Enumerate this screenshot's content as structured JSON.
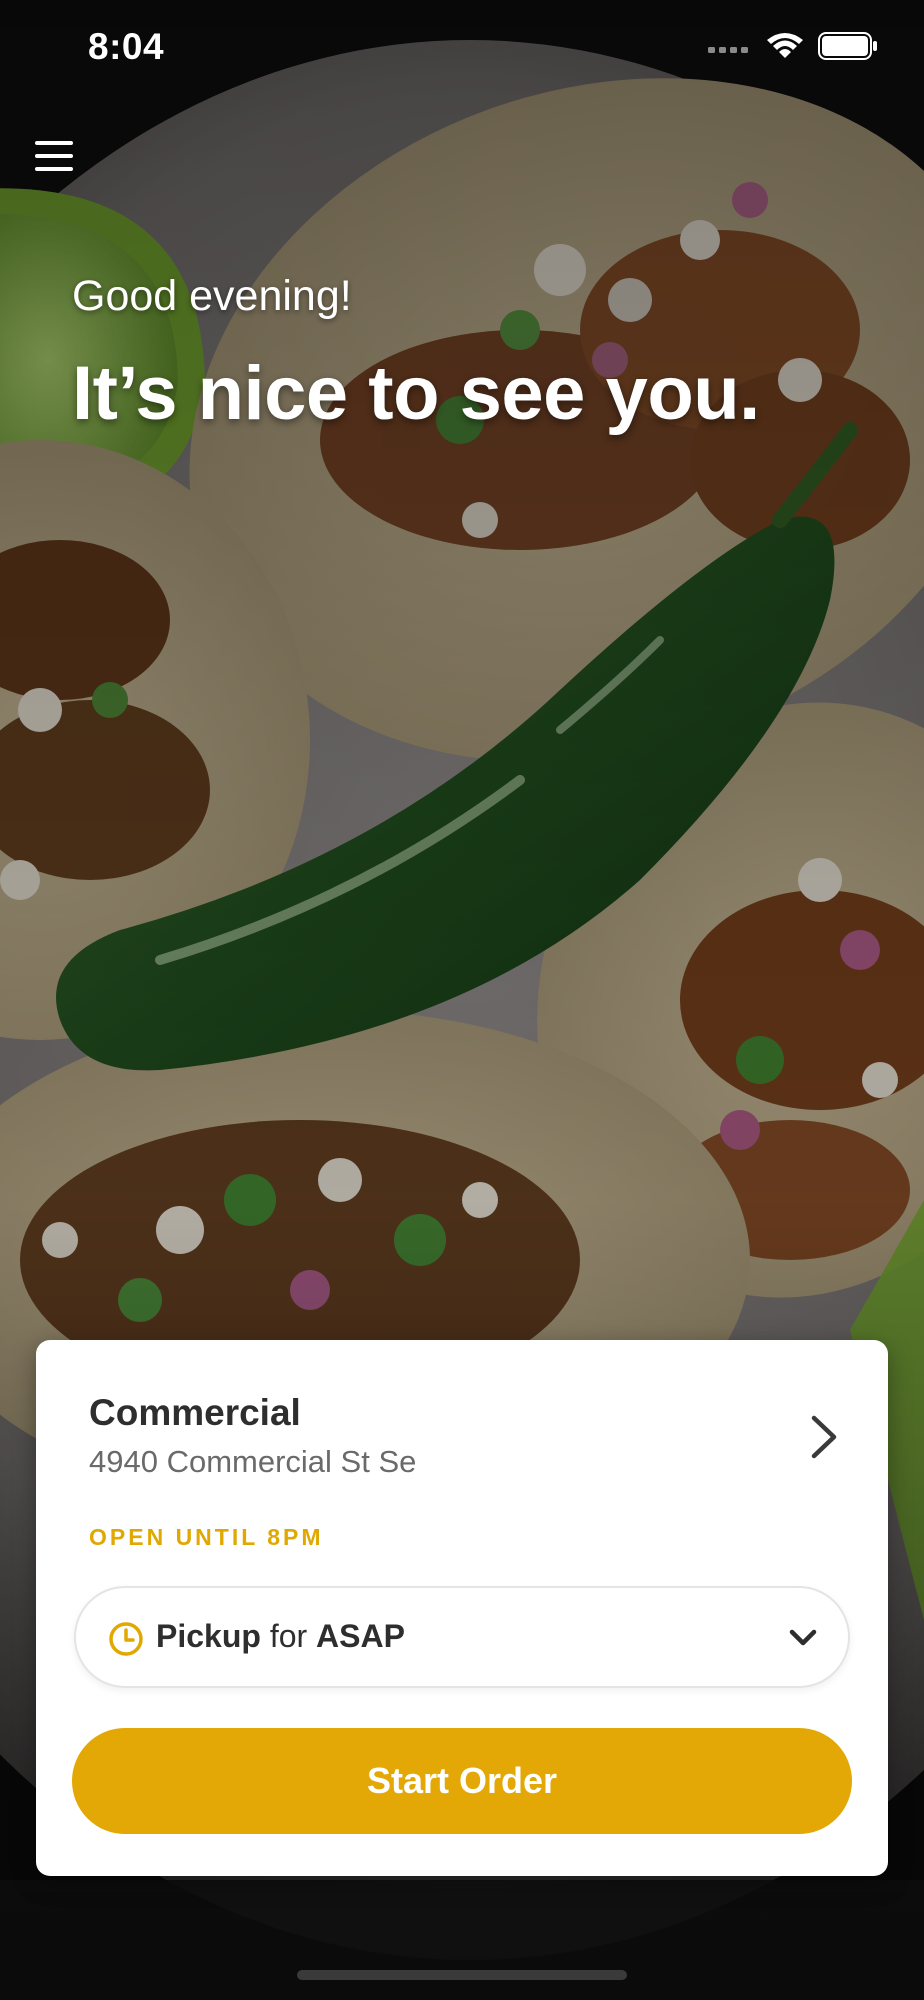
{
  "status_bar": {
    "time": "8:04",
    "icons": [
      "signal-icon",
      "wifi-icon",
      "battery-icon"
    ]
  },
  "header": {
    "menu_icon": "hamburger-menu-icon"
  },
  "greeting": {
    "small": "Good evening!",
    "large": "It’s nice to see you."
  },
  "location": {
    "name": "Commercial",
    "address": "4940 Commercial St Se",
    "hours_status": "OPEN UNTIL 8PM"
  },
  "order_mode": {
    "mode": "Pickup",
    "connector": "for",
    "time": "ASAP"
  },
  "actions": {
    "start_order_label": "Start Order"
  },
  "colors": {
    "accent": "#e3a806",
    "hours_text": "#e0a800",
    "card_background": "#ffffff",
    "title_text": "#2e2e2e",
    "secondary_text": "#6a6a6a"
  }
}
